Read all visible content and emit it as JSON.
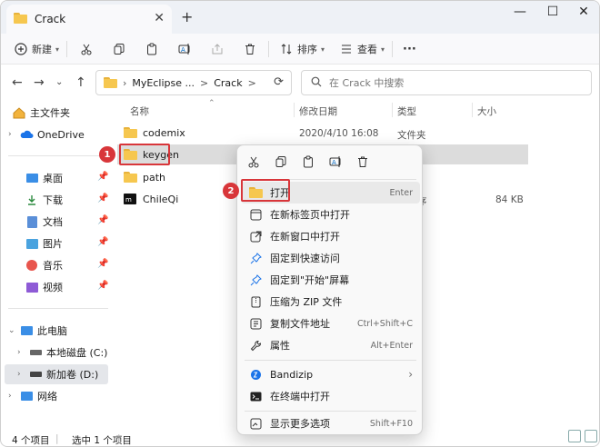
{
  "tab": {
    "title": "Crack",
    "close": "✕",
    "new": "+"
  },
  "window_controls": {
    "minimize": "—",
    "maximize": "☐",
    "close": "✕"
  },
  "toolbar": {
    "new_label": "新建",
    "sort_label": "排序",
    "view_label": "查看",
    "more": "···"
  },
  "address": {
    "parts": [
      "MyEclipse ...",
      ">",
      "Crack",
      ">"
    ]
  },
  "search": {
    "placeholder": "在 Crack 中搜索"
  },
  "sidebar": {
    "items": [
      {
        "label": "主文件夹"
      },
      {
        "label": "OneDrive"
      },
      {
        "label": "桌面"
      },
      {
        "label": "下载"
      },
      {
        "label": "文档"
      },
      {
        "label": "图片"
      },
      {
        "label": "音乐"
      },
      {
        "label": "视频"
      },
      {
        "label": "此电脑"
      },
      {
        "label": "本地磁盘 (C:)"
      },
      {
        "label": "新加卷 (D:)"
      },
      {
        "label": "网络"
      }
    ]
  },
  "columns": {
    "name": "名称",
    "modified": "修改日期",
    "type": "类型",
    "size": "大小"
  },
  "files": [
    {
      "name": "codemix",
      "modified": "2020/4/10 16:08",
      "type": "文件夹",
      "size": ""
    },
    {
      "name": "keygen",
      "modified": "",
      "type": "",
      "size": ""
    },
    {
      "name": "path",
      "modified": "",
      "type": "",
      "size": ""
    },
    {
      "name": "ChileQi",
      "modified": "",
      "type": "序",
      "size": "84 KB"
    }
  ],
  "status": {
    "count": "4 个项目",
    "selected": "选中 1 个项目"
  },
  "context_menu": {
    "items": [
      {
        "label": "打开",
        "key": "Enter"
      },
      {
        "label": "在新标签页中打开",
        "key": ""
      },
      {
        "label": "在新窗口中打开",
        "key": ""
      },
      {
        "label": "固定到快速访问",
        "key": ""
      },
      {
        "label": "固定到\"开始\"屏幕",
        "key": ""
      },
      {
        "label": "压缩为 ZIP 文件",
        "key": ""
      },
      {
        "label": "复制文件地址",
        "key": "Ctrl+Shift+C"
      },
      {
        "label": "属性",
        "key": "Alt+Enter"
      },
      {
        "label": "Bandizip",
        "key": "›"
      },
      {
        "label": "在终端中打开",
        "key": ""
      },
      {
        "label": "显示更多选项",
        "key": "Shift+F10"
      }
    ]
  },
  "annotations": {
    "badge1": "1",
    "badge2": "2"
  },
  "colors": {
    "accent": "#0067c0",
    "highlight_red": "#d8363a",
    "folder": "#f6c74f"
  }
}
